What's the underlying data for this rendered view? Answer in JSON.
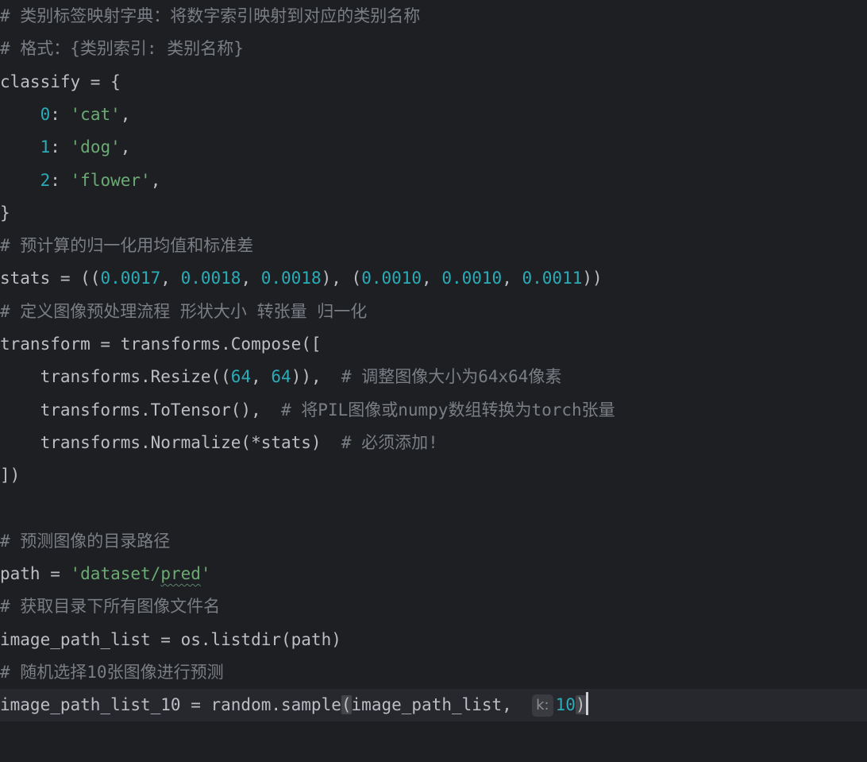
{
  "editor": {
    "lines": [
      {
        "segments": [
          {
            "text": "# 类别标签映射字典：将数字索引映射到对应的类别名称",
            "kind": "comment"
          }
        ]
      },
      {
        "segments": [
          {
            "text": "# 格式：{类别索引: 类别名称}",
            "kind": "comment"
          }
        ]
      },
      {
        "segments": [
          {
            "text": "classify = {",
            "kind": "plain"
          }
        ]
      },
      {
        "segments": [
          {
            "text": "    ",
            "kind": "plain"
          },
          {
            "text": "0",
            "kind": "num"
          },
          {
            "text": ": ",
            "kind": "plain"
          },
          {
            "text": "'cat'",
            "kind": "str"
          },
          {
            "text": ",",
            "kind": "plain"
          }
        ]
      },
      {
        "segments": [
          {
            "text": "    ",
            "kind": "plain"
          },
          {
            "text": "1",
            "kind": "num"
          },
          {
            "text": ": ",
            "kind": "plain"
          },
          {
            "text": "'dog'",
            "kind": "str"
          },
          {
            "text": ",",
            "kind": "plain"
          }
        ]
      },
      {
        "segments": [
          {
            "text": "    ",
            "kind": "plain"
          },
          {
            "text": "2",
            "kind": "num"
          },
          {
            "text": ": ",
            "kind": "plain"
          },
          {
            "text": "'flower'",
            "kind": "str"
          },
          {
            "text": ",",
            "kind": "plain"
          }
        ]
      },
      {
        "segments": [
          {
            "text": "}",
            "kind": "plain"
          }
        ]
      },
      {
        "segments": [
          {
            "text": "# 预计算的归一化用均值和标准差",
            "kind": "comment"
          }
        ]
      },
      {
        "segments": [
          {
            "text": "stats = ((",
            "kind": "plain"
          },
          {
            "text": "0.0017",
            "kind": "num"
          },
          {
            "text": ", ",
            "kind": "plain"
          },
          {
            "text": "0.0018",
            "kind": "num"
          },
          {
            "text": ", ",
            "kind": "plain"
          },
          {
            "text": "0.0018",
            "kind": "num"
          },
          {
            "text": "), (",
            "kind": "plain"
          },
          {
            "text": "0.0010",
            "kind": "num"
          },
          {
            "text": ", ",
            "kind": "plain"
          },
          {
            "text": "0.0010",
            "kind": "num"
          },
          {
            "text": ", ",
            "kind": "plain"
          },
          {
            "text": "0.0011",
            "kind": "num"
          },
          {
            "text": "))",
            "kind": "plain"
          }
        ]
      },
      {
        "segments": [
          {
            "text": "# 定义图像预处理流程 形状大小 转张量 归一化",
            "kind": "comment"
          }
        ]
      },
      {
        "segments": [
          {
            "text": "transform = transforms.Compose([",
            "kind": "plain"
          }
        ]
      },
      {
        "segments": [
          {
            "text": "    transforms.Resize((",
            "kind": "plain"
          },
          {
            "text": "64",
            "kind": "num"
          },
          {
            "text": ", ",
            "kind": "plain"
          },
          {
            "text": "64",
            "kind": "num"
          },
          {
            "text": ")),  ",
            "kind": "plain"
          },
          {
            "text": "# 调整图像大小为64x64像素",
            "kind": "comment"
          }
        ]
      },
      {
        "segments": [
          {
            "text": "    transforms.ToTensor(),  ",
            "kind": "plain"
          },
          {
            "text": "# 将PIL图像或numpy数组转换为torch张量",
            "kind": "comment"
          }
        ]
      },
      {
        "segments": [
          {
            "text": "    transforms.Normalize(*stats)  ",
            "kind": "plain"
          },
          {
            "text": "# 必须添加!",
            "kind": "comment"
          }
        ]
      },
      {
        "segments": [
          {
            "text": "])",
            "kind": "plain"
          }
        ]
      },
      {
        "segments": []
      },
      {
        "segments": [
          {
            "text": "# 预测图像的目录路径",
            "kind": "comment"
          }
        ]
      },
      {
        "segments": [
          {
            "text": "path = ",
            "kind": "plain"
          },
          {
            "text": "'dataset/",
            "kind": "str"
          },
          {
            "text": "pred",
            "kind": "str-squiggle"
          },
          {
            "text": "'",
            "kind": "str"
          }
        ]
      },
      {
        "segments": [
          {
            "text": "# 获取目录下所有图像文件名",
            "kind": "comment"
          }
        ]
      },
      {
        "segments": [
          {
            "text": "image_path_list = os.listdir(path)",
            "kind": "plain"
          }
        ]
      },
      {
        "segments": [
          {
            "text": "# 随机选择10张图像进行预测",
            "kind": "comment"
          }
        ]
      },
      {
        "current": true,
        "segments": [
          {
            "text": "image_path_list_10 = random.sample",
            "kind": "plain"
          },
          {
            "text": "(",
            "kind": "paren"
          },
          {
            "text": "image_path_list,  ",
            "kind": "plain"
          },
          {
            "text": "k:",
            "kind": "hint"
          },
          {
            "text": "10",
            "kind": "num"
          },
          {
            "text": ")",
            "kind": "paren"
          },
          {
            "text": "",
            "kind": "caret"
          }
        ]
      }
    ]
  }
}
